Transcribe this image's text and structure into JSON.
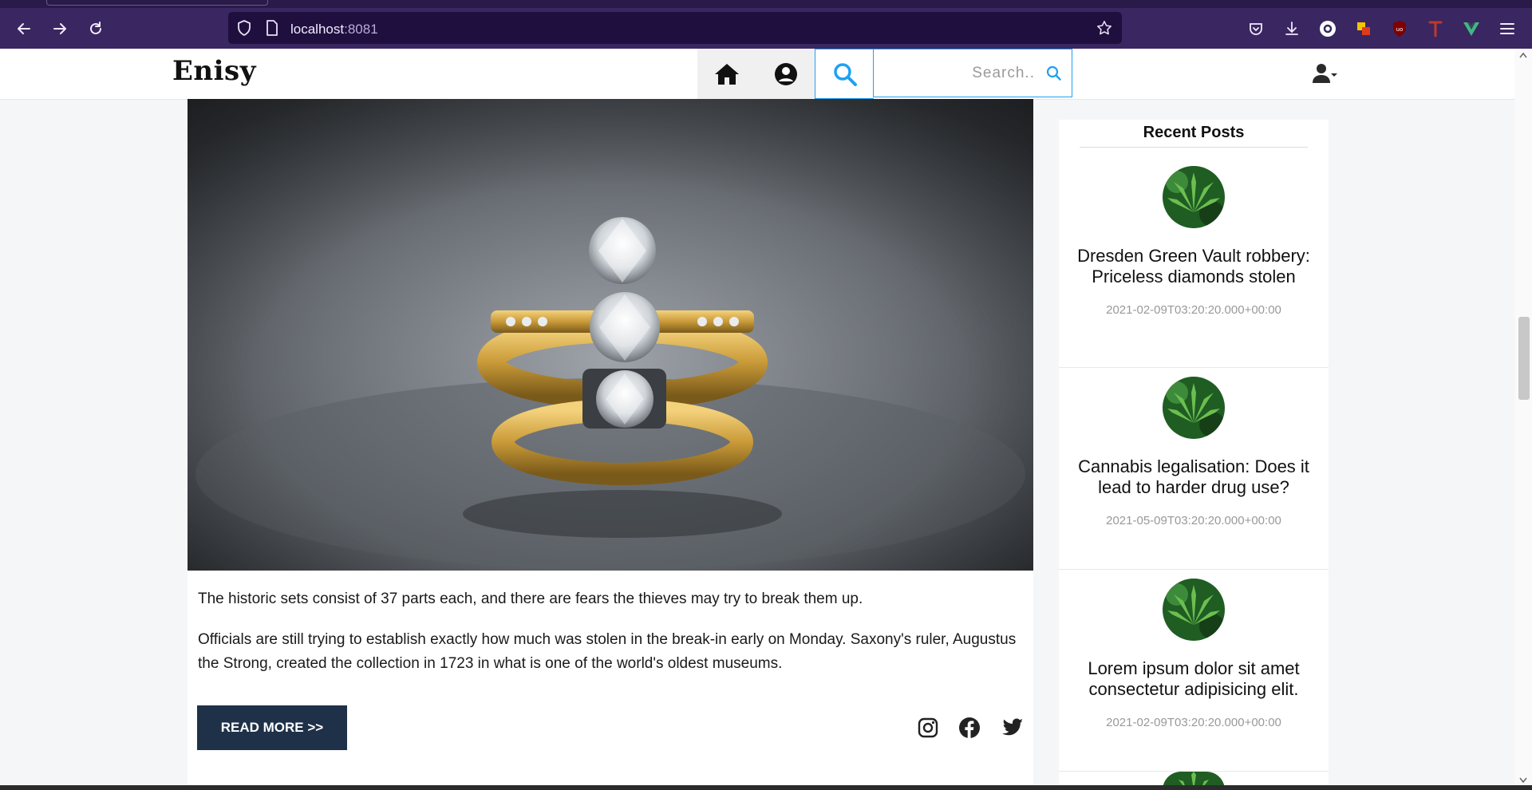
{
  "browser": {
    "url_host": "localhost",
    "url_port": ":8081"
  },
  "header": {
    "logo": "Enisy",
    "search": {
      "placeholder": "Search..",
      "value": ""
    }
  },
  "post": {
    "paragraphs": [
      "The historic sets consist of 37 parts each, and there are fears the thieves may try to break them up.",
      "Officials are still trying to establish exactly how much was stolen in the break-in early on Monday. Saxony's ruler, Augustus the Strong, created the collection in 1723 in what is one of the world's oldest museums."
    ],
    "read_more_label": "READ MORE >>"
  },
  "sidebar": {
    "title": "Recent Posts",
    "items": [
      {
        "title": "Dresden Green Vault robbery: Priceless diamonds stolen",
        "date": "2021-02-09T03:20:20.000+00:00"
      },
      {
        "title": "Cannabis legalisation: Does it lead to harder drug use?",
        "date": "2021-05-09T03:20:20.000+00:00"
      },
      {
        "title": "Lorem ipsum dolor sit amet consectetur adipisicing elit.",
        "date": "2021-02-09T03:20:20.000+00:00"
      }
    ]
  },
  "colors": {
    "browser_chrome": "#3a2660",
    "url_bar": "#1f0f3f",
    "accent": "#1da1f2",
    "read_more_bg": "#1e3148"
  },
  "icons": {
    "header_nav": [
      "home-icon",
      "user-circle-icon",
      "search-icon"
    ],
    "social": [
      "instagram-icon",
      "facebook-icon",
      "twitter-icon"
    ]
  }
}
